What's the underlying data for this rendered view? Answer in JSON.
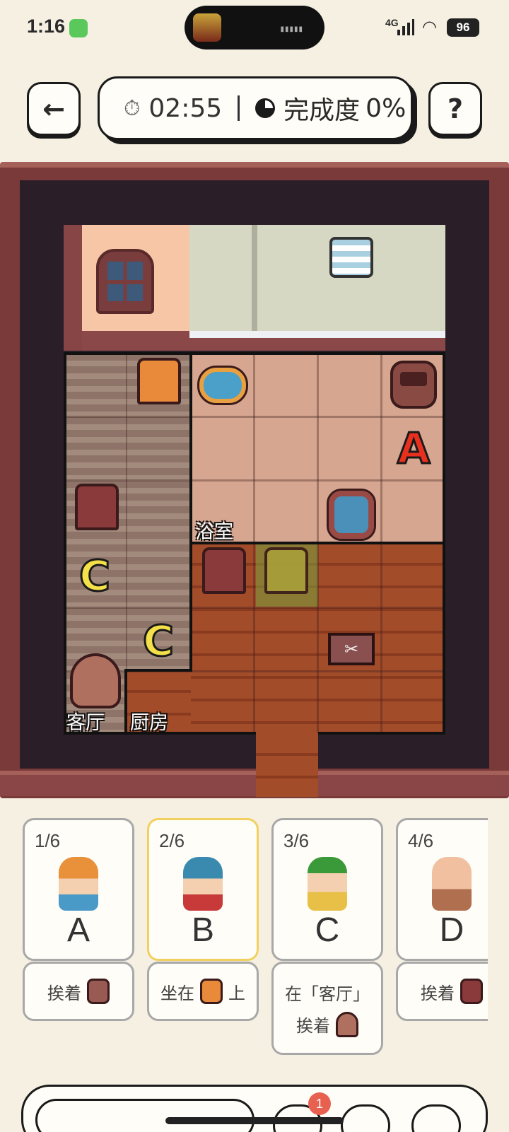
{
  "status_bar": {
    "time": "1:16",
    "network": "4G",
    "battery": "96"
  },
  "header": {
    "timer": "02:55",
    "progress_label": "完成度",
    "progress_value": "0%",
    "help_label": "?"
  },
  "board": {
    "rooms": {
      "bathroom": "浴室",
      "living_room": "客厅",
      "kitchen": "厨房"
    },
    "placed_letters": {
      "a": "A",
      "c1": "C",
      "c2": "C"
    },
    "icons": [
      "window-icon",
      "towel-icon",
      "chair-orange-icon",
      "bathtub-icon",
      "armchair-icon",
      "chair-brown-icon",
      "sink-icon",
      "chair-olive-icon",
      "sack-person-icon",
      "toolbox-icon"
    ]
  },
  "characters": [
    {
      "index": "1/6",
      "letter": "A",
      "clue_prefix": "挨着",
      "clue_suffix": "",
      "clue_icon": "armchair-icon"
    },
    {
      "index": "2/6",
      "letter": "B",
      "clue_prefix": "坐在",
      "clue_suffix": "上",
      "clue_icon": "chair-orange-icon"
    },
    {
      "index": "3/6",
      "letter": "C",
      "clue_line1": "在「客厅」",
      "clue_prefix": "挨着",
      "clue_icon": "sack-person-icon"
    },
    {
      "index": "4/6",
      "letter": "D",
      "clue_prefix": "挨着",
      "clue_suffix": "",
      "clue_icon": "chair-brown-icon"
    }
  ],
  "bottom": {
    "badge_count": "1"
  },
  "colors": {
    "background": "#f6f0e2",
    "frame": "#7a3a3a",
    "active_card": "#f2d060",
    "letter_a": "#e8301e",
    "letter_c": "#f4e048"
  }
}
